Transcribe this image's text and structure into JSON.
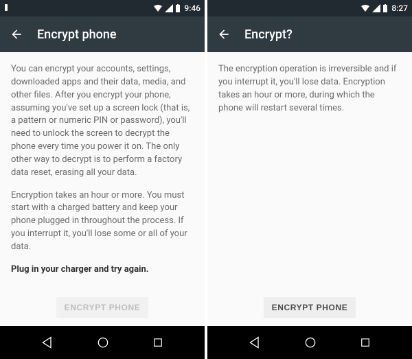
{
  "screens": {
    "left": {
      "status": {
        "time": "9:46",
        "has_notification": true
      },
      "appbar": {
        "title": "Encrypt phone"
      },
      "body": {
        "p1": "You can encrypt your accounts, settings, downloaded apps and their data, media, and other files. After you encrypt your phone, assuming you've set up a screen lock (that is, a pattern or numeric PIN or password), you'll need to unlock the screen to decrypt the phone every time you power it on. The only other way to decrypt is to perform a factory data reset, erasing all your data.",
        "p2": "Encryption takes an hour or more. You must start with a charged battery and keep your phone plugged in throughout the process. If you interrupt it, you'll lose some or all of your data.",
        "bold": "Plug in your charger and try again."
      },
      "cta": {
        "label": "ENCRYPT PHONE",
        "enabled": false
      }
    },
    "right": {
      "status": {
        "time": "8:27",
        "has_notification": false
      },
      "appbar": {
        "title": "Encrypt?"
      },
      "body": {
        "p1": "The encryption operation is irreversible and if you interrupt it, you'll lose data. Encryption takes an hour or more, during which the phone will restart several times."
      },
      "cta": {
        "label": "ENCRYPT PHONE",
        "enabled": true
      }
    }
  }
}
